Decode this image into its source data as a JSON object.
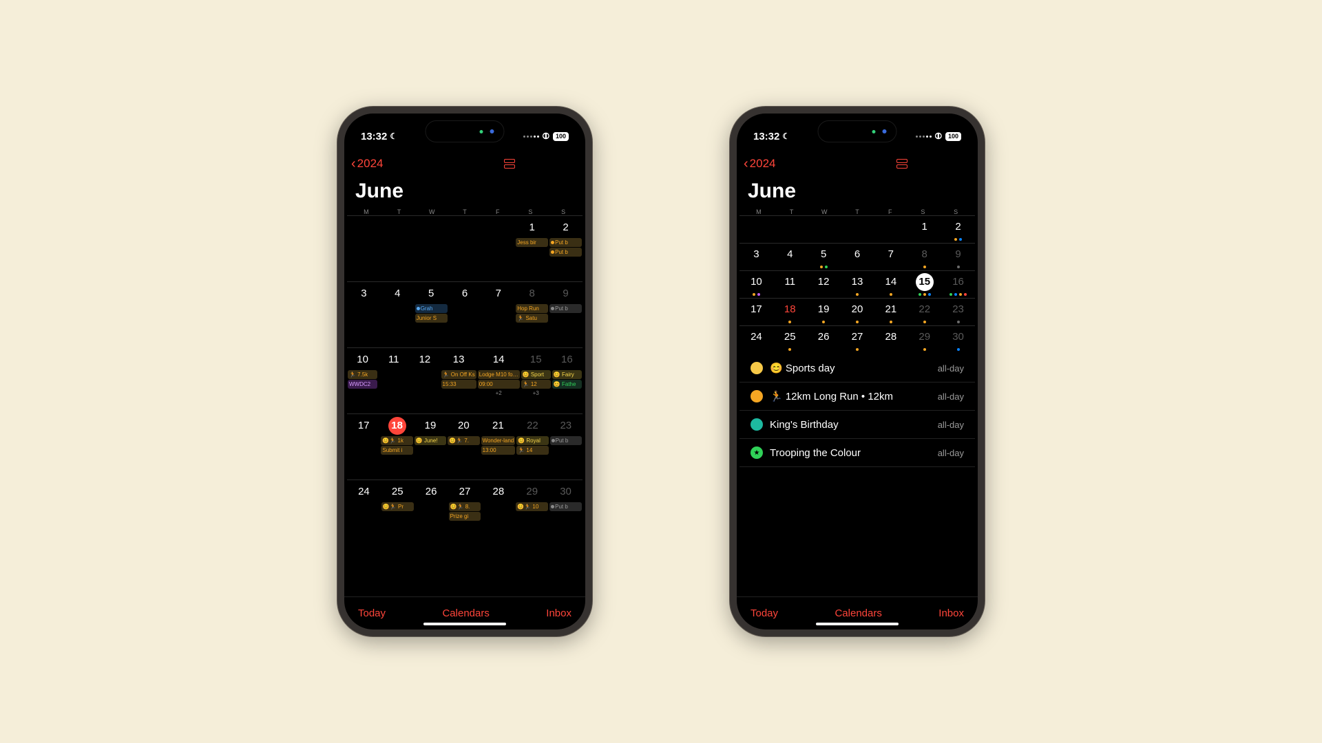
{
  "status": {
    "time": "13:32",
    "battery": "100"
  },
  "nav": {
    "year": "2024",
    "month": "June"
  },
  "weekdays": [
    "M",
    "T",
    "W",
    "T",
    "F",
    "S",
    "S"
  ],
  "bottom": {
    "today": "Today",
    "calendars": "Calendars",
    "inbox": "Inbox"
  },
  "left_phone": {
    "weeks": [
      {
        "days": [
          {
            "n": ""
          },
          {
            "n": ""
          },
          {
            "n": ""
          },
          {
            "n": ""
          },
          {
            "n": ""
          },
          {
            "n": "1",
            "events": [
              {
                "t": "Jess bir",
                "c": "orange"
              }
            ]
          },
          {
            "n": "2",
            "events": [
              {
                "t": "Put b",
                "c": "orange",
                "dot": true
              },
              {
                "t": "Put b",
                "c": "orange",
                "dot": true
              }
            ]
          }
        ]
      },
      {
        "days": [
          {
            "n": "3"
          },
          {
            "n": "4"
          },
          {
            "n": "5",
            "events": [
              {
                "t": "Grah",
                "c": "blue",
                "dot": true
              },
              {
                "t": "Junior S",
                "c": "orange"
              }
            ]
          },
          {
            "n": "6"
          },
          {
            "n": "7"
          },
          {
            "n": "8",
            "muted": true,
            "events": [
              {
                "t": "Hop Run",
                "c": "orange"
              },
              {
                "t": "🏃 Satu",
                "c": "orange"
              }
            ]
          },
          {
            "n": "9",
            "muted": true,
            "events": [
              {
                "t": "Put b",
                "c": "gray",
                "dot": true
              }
            ]
          }
        ]
      },
      {
        "days": [
          {
            "n": "10",
            "events": [
              {
                "t": "🏃 7.5k",
                "c": "orange"
              },
              {
                "t": "WWDC2",
                "c": "purple"
              }
            ]
          },
          {
            "n": "11"
          },
          {
            "n": "12"
          },
          {
            "n": "13",
            "events": [
              {
                "t": "🏃 On Off Ks",
                "c": "orange"
              },
              {
                "t": "15:33",
                "c": "orange",
                "plain": true
              }
            ]
          },
          {
            "n": "14",
            "events": [
              {
                "t": "Lodge M10 fo…",
                "c": "orange"
              },
              {
                "t": "09:00",
                "c": "orange",
                "plain": true
              }
            ],
            "more": "+2"
          },
          {
            "n": "15",
            "muted": true,
            "events": [
              {
                "t": "😊 Sport",
                "c": "yellow"
              },
              {
                "t": "🏃 12",
                "c": "orange"
              }
            ],
            "more": "+3"
          },
          {
            "n": "16",
            "muted": true,
            "events": [
              {
                "t": "😊 Fairy",
                "c": "yellow"
              },
              {
                "t": "😊 Fathe",
                "c": "green"
              }
            ]
          }
        ]
      },
      {
        "days": [
          {
            "n": "17"
          },
          {
            "n": "18",
            "today": true,
            "events": [
              {
                "t": "😊🏃 1k",
                "c": "orange"
              },
              {
                "t": "Submit i",
                "c": "orange",
                "plain": true
              }
            ]
          },
          {
            "n": "19",
            "events": [
              {
                "t": "😊 June!",
                "c": "yellow"
              }
            ]
          },
          {
            "n": "20",
            "events": [
              {
                "t": "😊🏃 7.",
                "c": "orange"
              }
            ]
          },
          {
            "n": "21",
            "events": [
              {
                "t": "Wonder-land",
                "c": "orange"
              },
              {
                "t": "13:00",
                "c": "orange",
                "plain": true
              }
            ]
          },
          {
            "n": "22",
            "muted": true,
            "events": [
              {
                "t": "😊 Royal",
                "c": "yellow"
              },
              {
                "t": "🏃 14",
                "c": "orange"
              }
            ]
          },
          {
            "n": "23",
            "muted": true,
            "events": [
              {
                "t": "Put b",
                "c": "gray",
                "dot": true
              }
            ]
          }
        ]
      },
      {
        "days": [
          {
            "n": "24"
          },
          {
            "n": "25",
            "events": [
              {
                "t": "😊🏃 Pr",
                "c": "orange"
              }
            ]
          },
          {
            "n": "26"
          },
          {
            "n": "27",
            "events": [
              {
                "t": "😊🏃 8.",
                "c": "orange"
              },
              {
                "t": "Prize gi",
                "c": "orange",
                "plain": true
              }
            ]
          },
          {
            "n": "28"
          },
          {
            "n": "29",
            "muted": true,
            "events": [
              {
                "t": "😊🏃 10",
                "c": "orange"
              }
            ]
          },
          {
            "n": "30",
            "muted": true,
            "events": [
              {
                "t": "Put b",
                "c": "gray",
                "dot": true
              }
            ]
          }
        ]
      }
    ]
  },
  "right_phone": {
    "weeks": [
      {
        "days": [
          {
            "n": ""
          },
          {
            "n": ""
          },
          {
            "n": ""
          },
          {
            "n": ""
          },
          {
            "n": ""
          },
          {
            "n": "1"
          },
          {
            "n": "2",
            "dots": [
              "o",
              "b"
            ]
          }
        ]
      },
      {
        "days": [
          {
            "n": "3"
          },
          {
            "n": "4"
          },
          {
            "n": "5",
            "dots": [
              "o",
              "g"
            ]
          },
          {
            "n": "6"
          },
          {
            "n": "7"
          },
          {
            "n": "8",
            "muted": true,
            "dots": [
              "o"
            ]
          },
          {
            "n": "9",
            "muted": true,
            "dots": [
              "gray"
            ]
          }
        ]
      },
      {
        "days": [
          {
            "n": "10",
            "dots": [
              "o",
              "p"
            ]
          },
          {
            "n": "11"
          },
          {
            "n": "12"
          },
          {
            "n": "13",
            "dots": [
              "o"
            ]
          },
          {
            "n": "14",
            "dots": [
              "o"
            ]
          },
          {
            "n": "15",
            "sel": true,
            "dots": [
              "g",
              "o",
              "b"
            ]
          },
          {
            "n": "16",
            "muted": true,
            "dots": [
              "g",
              "b",
              "o",
              "r"
            ]
          }
        ]
      },
      {
        "days": [
          {
            "n": "17"
          },
          {
            "n": "18",
            "redtext": true,
            "dots": [
              "o"
            ]
          },
          {
            "n": "19",
            "dots": [
              "o"
            ]
          },
          {
            "n": "20",
            "dots": [
              "o"
            ]
          },
          {
            "n": "21",
            "dots": [
              "o"
            ]
          },
          {
            "n": "22",
            "muted": true,
            "dots": [
              "o"
            ]
          },
          {
            "n": "23",
            "muted": true,
            "dots": [
              "gray"
            ]
          }
        ]
      },
      {
        "days": [
          {
            "n": "24"
          },
          {
            "n": "25",
            "dots": [
              "o"
            ]
          },
          {
            "n": "26"
          },
          {
            "n": "27",
            "dots": [
              "o"
            ]
          },
          {
            "n": "28"
          },
          {
            "n": "29",
            "muted": true,
            "dots": [
              "o"
            ]
          },
          {
            "n": "30",
            "muted": true,
            "dots": [
              "b"
            ]
          }
        ]
      }
    ],
    "selected_events": [
      {
        "dot": "yellow",
        "icon": "😊",
        "title": "Sports day",
        "time": "all-day"
      },
      {
        "dot": "orange",
        "icon": "🏃",
        "title": "12km Long Run • 12km",
        "time": "all-day"
      },
      {
        "dot": "teal",
        "icon": "",
        "title": "King's Birthday",
        "time": "all-day"
      },
      {
        "dot": "green",
        "icon": "★",
        "title": "Trooping the Colour",
        "time": "all-day"
      }
    ]
  }
}
